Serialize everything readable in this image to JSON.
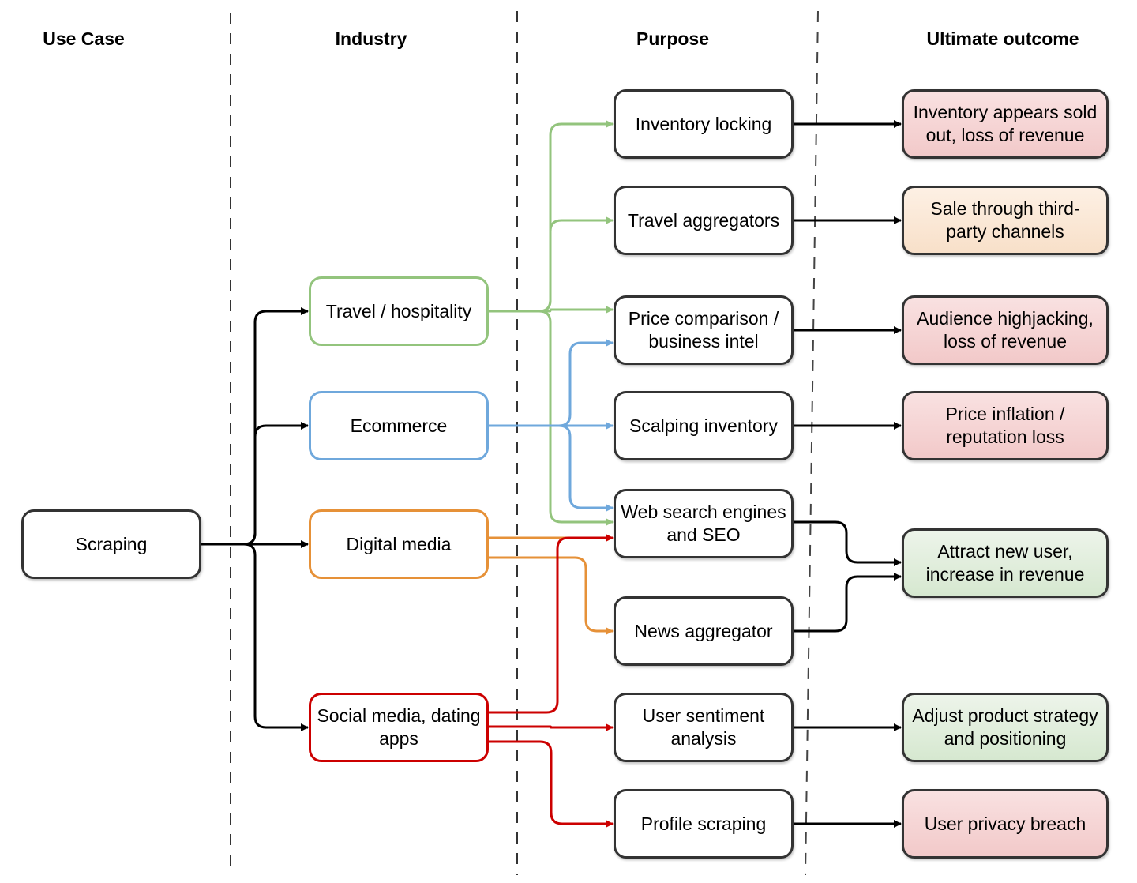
{
  "columns": [
    {
      "id": "use_case",
      "label": "Use Case"
    },
    {
      "id": "industry",
      "label": "Industry"
    },
    {
      "id": "purpose",
      "label": "Purpose"
    },
    {
      "id": "outcome",
      "label": "Ultimate outcome"
    }
  ],
  "colors": {
    "green": "#93c47d",
    "blue": "#6fa8dc",
    "orange": "#e69138",
    "red": "#cc0000",
    "black": "#000000",
    "outcome_negative": "#f4cccc",
    "outcome_mixed": "#fce5cd",
    "outcome_positive": "#d9ead3"
  },
  "nodes": {
    "scraping": {
      "label": "Scraping"
    },
    "travel": {
      "label": "Travel / hospitality"
    },
    "ecommerce": {
      "label": "Ecommerce"
    },
    "digital_media": {
      "label": "Digital media"
    },
    "social_media": {
      "label": "Social media, dating apps"
    },
    "inventory_locking": {
      "label": "Inventory locking"
    },
    "travel_aggregators": {
      "label": "Travel aggregators"
    },
    "price_comparison": {
      "label": "Price comparison / business intel"
    },
    "scalping": {
      "label": "Scalping inventory"
    },
    "web_search": {
      "label": "Web search engines and SEO"
    },
    "news_aggregator": {
      "label": "News aggregator"
    },
    "user_sentiment": {
      "label": "User sentiment analysis"
    },
    "profile_scraping": {
      "label": "Profile scraping"
    },
    "out_sold_out": {
      "label": "Inventory appears sold out, loss of revenue",
      "tone": "negative"
    },
    "out_third_party": {
      "label": "Sale through third-party channels",
      "tone": "mixed"
    },
    "out_audience": {
      "label": "Audience highjacking, loss of revenue",
      "tone": "negative"
    },
    "out_price_inflation": {
      "label": "Price inflation / reputation loss",
      "tone": "negative"
    },
    "out_attract": {
      "label": "Attract new user, increase in revenue",
      "tone": "positive"
    },
    "out_adjust": {
      "label": "Adjust product strategy and positioning",
      "tone": "positive"
    },
    "out_privacy": {
      "label": "User privacy breach",
      "tone": "negative"
    }
  },
  "edges": [
    {
      "from": "scraping",
      "to": "travel",
      "color": "black"
    },
    {
      "from": "scraping",
      "to": "ecommerce",
      "color": "black"
    },
    {
      "from": "scraping",
      "to": "digital_media",
      "color": "black"
    },
    {
      "from": "scraping",
      "to": "social_media",
      "color": "black"
    },
    {
      "from": "travel",
      "to": "inventory_locking",
      "color": "green"
    },
    {
      "from": "travel",
      "to": "travel_aggregators",
      "color": "green"
    },
    {
      "from": "travel",
      "to": "price_comparison",
      "color": "green"
    },
    {
      "from": "travel",
      "to": "web_search",
      "color": "green"
    },
    {
      "from": "ecommerce",
      "to": "price_comparison",
      "color": "blue"
    },
    {
      "from": "ecommerce",
      "to": "scalping",
      "color": "blue"
    },
    {
      "from": "ecommerce",
      "to": "web_search",
      "color": "blue"
    },
    {
      "from": "digital_media",
      "to": "web_search",
      "color": "orange"
    },
    {
      "from": "digital_media",
      "to": "news_aggregator",
      "color": "orange"
    },
    {
      "from": "social_media",
      "to": "web_search",
      "color": "red"
    },
    {
      "from": "social_media",
      "to": "user_sentiment",
      "color": "red"
    },
    {
      "from": "social_media",
      "to": "profile_scraping",
      "color": "red"
    },
    {
      "from": "inventory_locking",
      "to": "out_sold_out",
      "color": "black"
    },
    {
      "from": "travel_aggregators",
      "to": "out_third_party",
      "color": "black"
    },
    {
      "from": "price_comparison",
      "to": "out_audience",
      "color": "black"
    },
    {
      "from": "scalping",
      "to": "out_price_inflation",
      "color": "black"
    },
    {
      "from": "web_search",
      "to": "out_attract",
      "color": "black"
    },
    {
      "from": "news_aggregator",
      "to": "out_attract",
      "color": "black"
    },
    {
      "from": "user_sentiment",
      "to": "out_adjust",
      "color": "black"
    },
    {
      "from": "profile_scraping",
      "to": "out_privacy",
      "color": "black"
    }
  ]
}
